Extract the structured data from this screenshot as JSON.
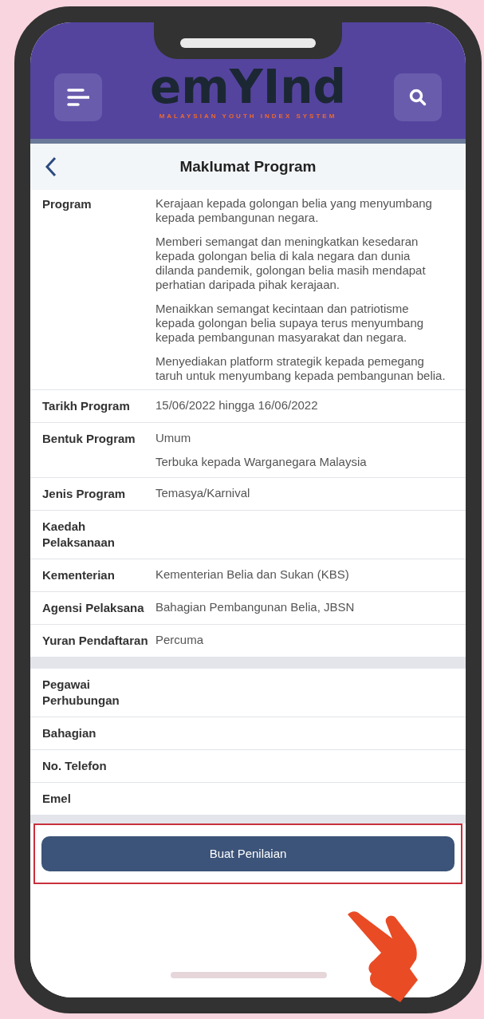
{
  "app": {
    "logo": "emYInd",
    "tagline": "MALAYSIAN YOUTH INDEX SYSTEM"
  },
  "page": {
    "title": "Maklumat Program"
  },
  "details": [
    {
      "label": "Program",
      "values": [
        "Kerajaan kepada golongan belia yang menyumbang kepada pembangunan negara.",
        "Memberi semangat dan meningkatkan kesedaran kepada golongan belia di kala negara dan dunia dilanda pandemik, golongan belia masih mendapat perhatian daripada pihak kerajaan.",
        "Menaikkan semangat kecintaan dan patriotisme kepada golongan belia supaya terus menyumbang kepada pembangunan masyarakat dan negara.",
        "Menyediakan platform strategik kepada pemegang taruh untuk menyumbang kepada pembangunan belia."
      ]
    },
    {
      "label": "Tarikh Program",
      "values": [
        "15/06/2022 hingga 16/06/2022"
      ]
    },
    {
      "label": "Bentuk Program",
      "values": [
        "Umum",
        "Terbuka kepada Warganegara Malaysia"
      ]
    },
    {
      "label": "Jenis Program",
      "values": [
        "Temasya/Karnival"
      ]
    },
    {
      "label": "Kaedah Pelaksanaan"
    },
    {
      "label": "Kementerian",
      "values": [
        "Kementerian Belia dan Sukan (KBS)"
      ]
    },
    {
      "label": "Agensi Pelaksana",
      "values": [
        "Bahagian Pembangunan Belia, JBSN"
      ]
    },
    {
      "label": "Yuran Pendaftaran",
      "values": [
        "Percuma"
      ]
    }
  ],
  "contact": [
    {
      "label": "Pegawai Perhubungan"
    },
    {
      "label": "Bahagian"
    },
    {
      "label": "No. Telefon"
    },
    {
      "label": "Emel"
    }
  ],
  "action": {
    "label": "Buat Penilaian"
  }
}
